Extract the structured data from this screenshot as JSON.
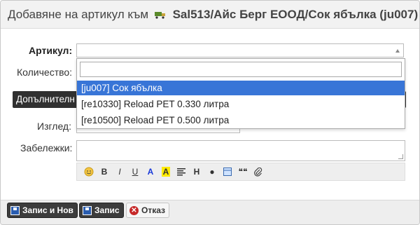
{
  "dialog": {
    "title_prefix": "Добавяне на артикул към",
    "title_code": "Sal513/Айс Берг ЕООД/Сок ябълка (ju007)"
  },
  "form": {
    "article_label": "Артикул:",
    "quantity_label": "Количество:",
    "section_label": "Допълнителн",
    "view_label": "Изглед:",
    "notes_label": "Забележки:",
    "article_options": [
      "[ju007] Сок ябълка",
      "[re10330] Reload PET 0.330 литра",
      "[re10500] Reload PET 0.500 литра"
    ],
    "selected_option_index": 0
  },
  "toolbar": {
    "bold": "B",
    "italic": "I",
    "underline": "U",
    "color": "A",
    "highlight": "A",
    "heading": "H",
    "bullet": "●",
    "quote": "❝❝"
  },
  "buttons": {
    "save_new": "Запис и Нов",
    "save": "Запис",
    "cancel": "Отказ"
  },
  "colors": {
    "selected_option": "#3875d7",
    "section_band": "#303030",
    "save_icon": "#2a5db0",
    "cancel_icon": "#c62828"
  }
}
